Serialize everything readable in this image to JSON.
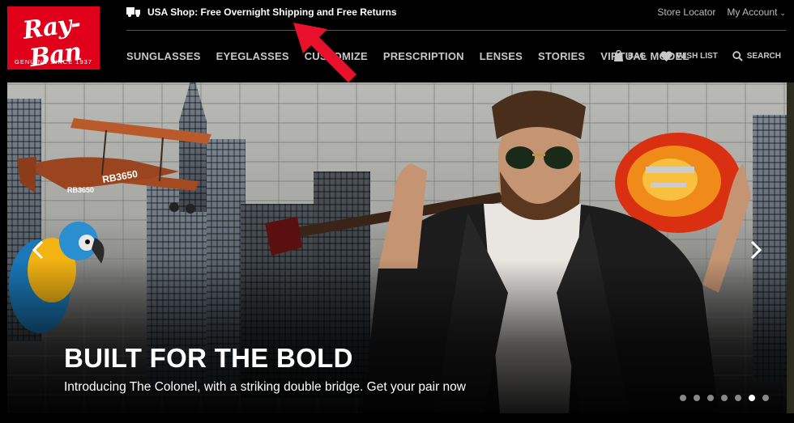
{
  "brand": {
    "logo_text": "Ray-Ban",
    "tagline": "GENUINE SINCE 1937",
    "logo_color": "#e1001a"
  },
  "topbar": {
    "promo_icon": "truck-icon",
    "promo_text": "USA Shop: Free Overnight Shipping and Free Returns",
    "store_locator": "Store Locator",
    "my_account": "My Account"
  },
  "nav": {
    "items": [
      {
        "label": "SUNGLASSES"
      },
      {
        "label": "EYEGLASSES"
      },
      {
        "label": "CUSTOMIZE"
      },
      {
        "label": "PRESCRIPTION"
      },
      {
        "label": "LENSES"
      },
      {
        "label": "STORIES"
      },
      {
        "label": "VIRTUAL MODEL"
      }
    ],
    "bag": "BAG",
    "wishlist": "WISH LIST",
    "search": "SEARCH"
  },
  "hero": {
    "title": "BUILT FOR THE BOLD",
    "subtitle": "Introducing The Colonel, with a striking double bridge. Get your pair now",
    "plane_text_1": "RB3650",
    "plane_text_2": "RB3650",
    "slide_count": 7,
    "active_slide": 6
  },
  "colors": {
    "accent_red": "#e1001a",
    "annotation_arrow": "#e8102a"
  }
}
